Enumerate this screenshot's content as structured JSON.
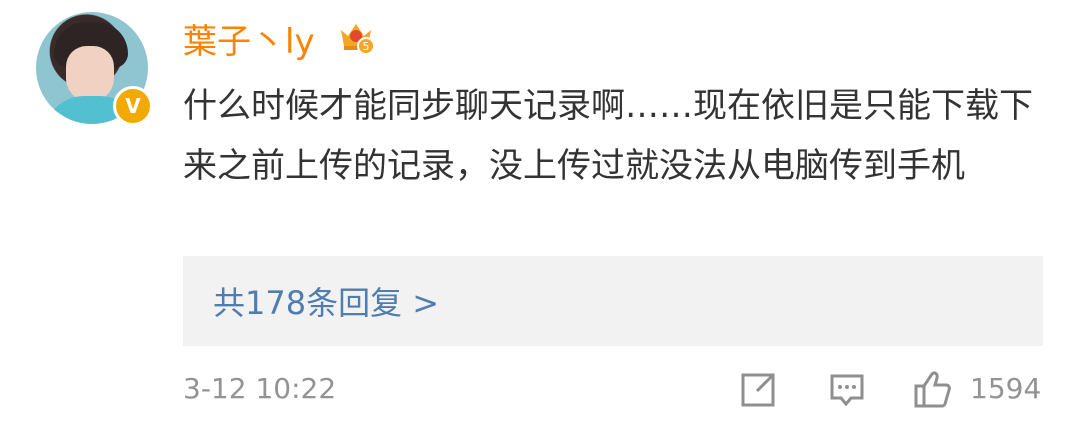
{
  "comment": {
    "username": "葉子丶ly",
    "content": "什么时候才能同步聊天记录啊……现在依旧是只能下载下来之前上传的记录，没上传过就没法从电脑传到手机",
    "replies_label": "共178条回复 >",
    "timestamp": "3-12 10:22",
    "like_count": "1594",
    "verified_mark": "V",
    "badge_level": "5"
  },
  "colors": {
    "username": "#ff8200",
    "link": "#507daf",
    "meta": "#939393",
    "badge": "#f2a900"
  },
  "icons": [
    "crown-badge-icon",
    "verified-icon",
    "share-icon",
    "comment-icon",
    "like-icon"
  ]
}
